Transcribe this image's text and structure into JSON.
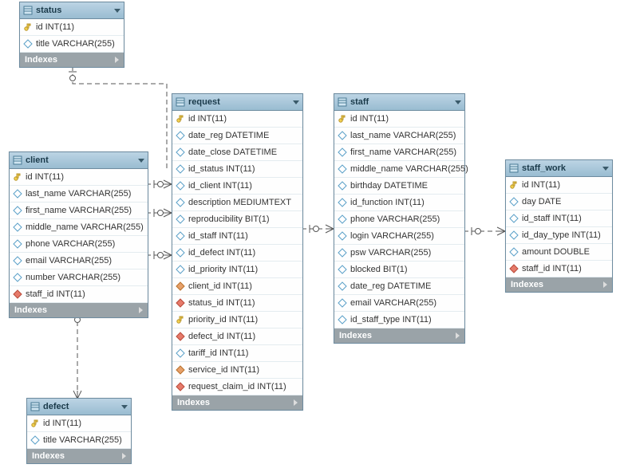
{
  "indexes_label": "Indexes",
  "tables": {
    "status": {
      "name": "status",
      "columns": [
        {
          "icon": "pk",
          "label": "id INT(11)"
        },
        {
          "icon": "col",
          "label": "title VARCHAR(255)"
        }
      ]
    },
    "client": {
      "name": "client",
      "columns": [
        {
          "icon": "pk",
          "label": "id INT(11)"
        },
        {
          "icon": "col",
          "label": "last_name VARCHAR(255)"
        },
        {
          "icon": "col",
          "label": "first_name VARCHAR(255)"
        },
        {
          "icon": "col",
          "label": "middle_name VARCHAR(255)"
        },
        {
          "icon": "col",
          "label": "phone VARCHAR(255)"
        },
        {
          "icon": "col",
          "label": "email VARCHAR(255)"
        },
        {
          "icon": "col",
          "label": "number VARCHAR(255)"
        },
        {
          "icon": "fk",
          "label": "staff_id INT(11)"
        }
      ]
    },
    "defect": {
      "name": "defect",
      "columns": [
        {
          "icon": "pk",
          "label": "id INT(11)"
        },
        {
          "icon": "col",
          "label": "title VARCHAR(255)"
        }
      ]
    },
    "request": {
      "name": "request",
      "columns": [
        {
          "icon": "pk",
          "label": "id INT(11)"
        },
        {
          "icon": "col",
          "label": "date_reg DATETIME"
        },
        {
          "icon": "col",
          "label": "date_close DATETIME"
        },
        {
          "icon": "col",
          "label": "id_status INT(11)"
        },
        {
          "icon": "col",
          "label": "id_client INT(11)"
        },
        {
          "icon": "col",
          "label": "description MEDIUMTEXT"
        },
        {
          "icon": "col",
          "label": "reproducibility BIT(1)"
        },
        {
          "icon": "col",
          "label": "id_staff INT(11)"
        },
        {
          "icon": "col",
          "label": "id_defect INT(11)"
        },
        {
          "icon": "col",
          "label": "id_priority INT(11)"
        },
        {
          "icon": "fknn",
          "label": "client_id INT(11)"
        },
        {
          "icon": "fk",
          "label": "status_id INT(11)"
        },
        {
          "icon": "pk",
          "label": "priority_id INT(11)"
        },
        {
          "icon": "fk",
          "label": "defect_id INT(11)"
        },
        {
          "icon": "col",
          "label": "tariff_id INT(11)"
        },
        {
          "icon": "fknn",
          "label": "service_id INT(11)"
        },
        {
          "icon": "fk",
          "label": "request_claim_id INT(11)"
        }
      ]
    },
    "staff": {
      "name": "staff",
      "columns": [
        {
          "icon": "pk",
          "label": "id INT(11)"
        },
        {
          "icon": "col",
          "label": "last_name VARCHAR(255)"
        },
        {
          "icon": "col",
          "label": "first_name VARCHAR(255)"
        },
        {
          "icon": "col",
          "label": "middle_name VARCHAR(255)"
        },
        {
          "icon": "col",
          "label": "birthday DATETIME"
        },
        {
          "icon": "col",
          "label": "id_function INT(11)"
        },
        {
          "icon": "col",
          "label": "phone VARCHAR(255)"
        },
        {
          "icon": "col",
          "label": "login VARCHAR(255)"
        },
        {
          "icon": "col",
          "label": "psw VARCHAR(255)"
        },
        {
          "icon": "col",
          "label": "blocked BIT(1)"
        },
        {
          "icon": "col",
          "label": "date_reg DATETIME"
        },
        {
          "icon": "col",
          "label": "email VARCHAR(255)"
        },
        {
          "icon": "col",
          "label": "id_staff_type INT(11)"
        }
      ]
    },
    "staff_work": {
      "name": "staff_work",
      "columns": [
        {
          "icon": "pk",
          "label": "id INT(11)"
        },
        {
          "icon": "col",
          "label": "day DATE"
        },
        {
          "icon": "col",
          "label": "id_staff INT(11)"
        },
        {
          "icon": "col",
          "label": "id_day_type INT(11)"
        },
        {
          "icon": "col",
          "label": "amount DOUBLE"
        },
        {
          "icon": "fk",
          "label": "staff_id INT(11)"
        }
      ]
    }
  }
}
